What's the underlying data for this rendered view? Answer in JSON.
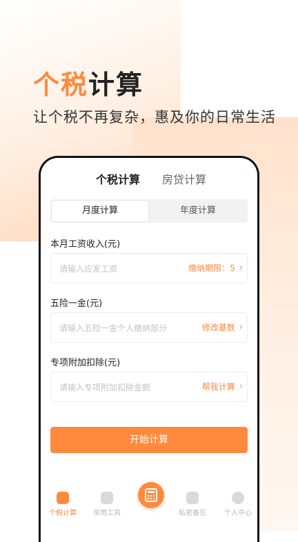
{
  "hero": {
    "title_accent": "个税",
    "title_rest": "计算",
    "subtitle": "让个税不再复杂，惠及你的日常生活"
  },
  "tabs": [
    {
      "label": "个税计算"
    },
    {
      "label": "房贷计算"
    }
  ],
  "segment": [
    {
      "label": "月度计算"
    },
    {
      "label": "年度计算"
    }
  ],
  "fields": [
    {
      "label": "本月工资收入(元)",
      "placeholder": "请输入应发工资",
      "action": "缴纳期限：5"
    },
    {
      "label": "五险一金(元)",
      "placeholder": "请输入五险一金个人缴纳部分",
      "action": "修改基数"
    },
    {
      "label": "专项附加扣除(元)",
      "placeholder": "请输入专项附加扣除金额",
      "action": "帮我计算"
    }
  ],
  "start_button": "开始计算",
  "bottom_nav": [
    {
      "label": "个税计算",
      "icon": "tax-calc-icon"
    },
    {
      "label": "常用工具",
      "icon": "tools-grid-icon"
    },
    {
      "label": "",
      "icon": "calculator-icon"
    },
    {
      "label": "私密备忘",
      "icon": "memo-icon"
    },
    {
      "label": "个人中心",
      "icon": "user-icon"
    }
  ],
  "colors": {
    "accent": "#ff8a3d",
    "text": "#222222",
    "muted": "#b8b8b8"
  }
}
